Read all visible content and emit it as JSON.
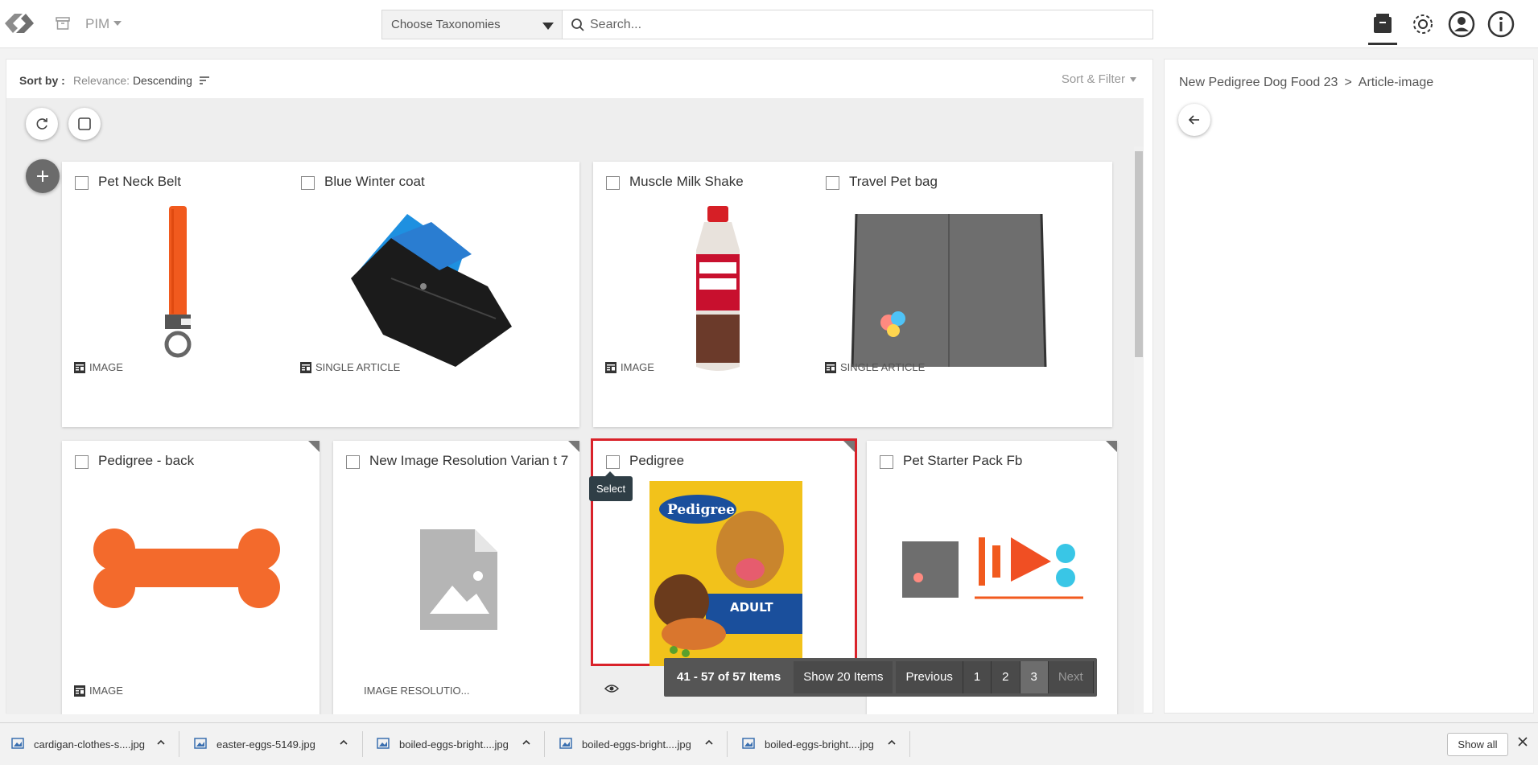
{
  "header": {
    "app_menu": "PIM",
    "taxonomy_select": "Choose Taxonomies",
    "search_placeholder": "Search..."
  },
  "sort": {
    "label": "Sort by :",
    "relevance": "Relevance:",
    "direction": "Descending",
    "sort_filter": "Sort & Filter"
  },
  "cards": [
    {
      "title": "Pet Neck Belt",
      "type": "IMAGE"
    },
    {
      "title": "Blue Winter coat",
      "type": "SINGLE ARTICLE"
    },
    {
      "title": "Muscle Milk Shake",
      "type": "IMAGE"
    },
    {
      "title": "Travel Pet bag",
      "type": "SINGLE ARTICLE"
    },
    {
      "title": "Pedigree - back",
      "type": "IMAGE"
    },
    {
      "title": "New Image Resolution Varian t 7",
      "type": "IMAGE RESOLUTIO..."
    },
    {
      "title": "Pedigree",
      "type": ""
    },
    {
      "title": "Pet Starter Pack Fb",
      "type": ""
    }
  ],
  "tooltip": "Select",
  "pager": {
    "count": "41 - 57 of 57 Items",
    "show": "Show 20 Items",
    "previous": "Previous",
    "pages": [
      "1",
      "2",
      "3"
    ],
    "current": "3",
    "next": "Next"
  },
  "right_panel": {
    "crumb_parent": "New Pedigree Dog Food 23",
    "crumb_separator": ">",
    "crumb_current": "Article-image"
  },
  "downloads": [
    "cardigan-clothes-s....jpg",
    "easter-eggs-5149.jpg",
    "boiled-eggs-bright....jpg",
    "boiled-eggs-bright....jpg",
    "boiled-eggs-bright....jpg"
  ],
  "shelf": {
    "show_all": "Show all"
  },
  "colors": {
    "selected_outline": "#d9222a",
    "pager_bg": "#555555"
  }
}
